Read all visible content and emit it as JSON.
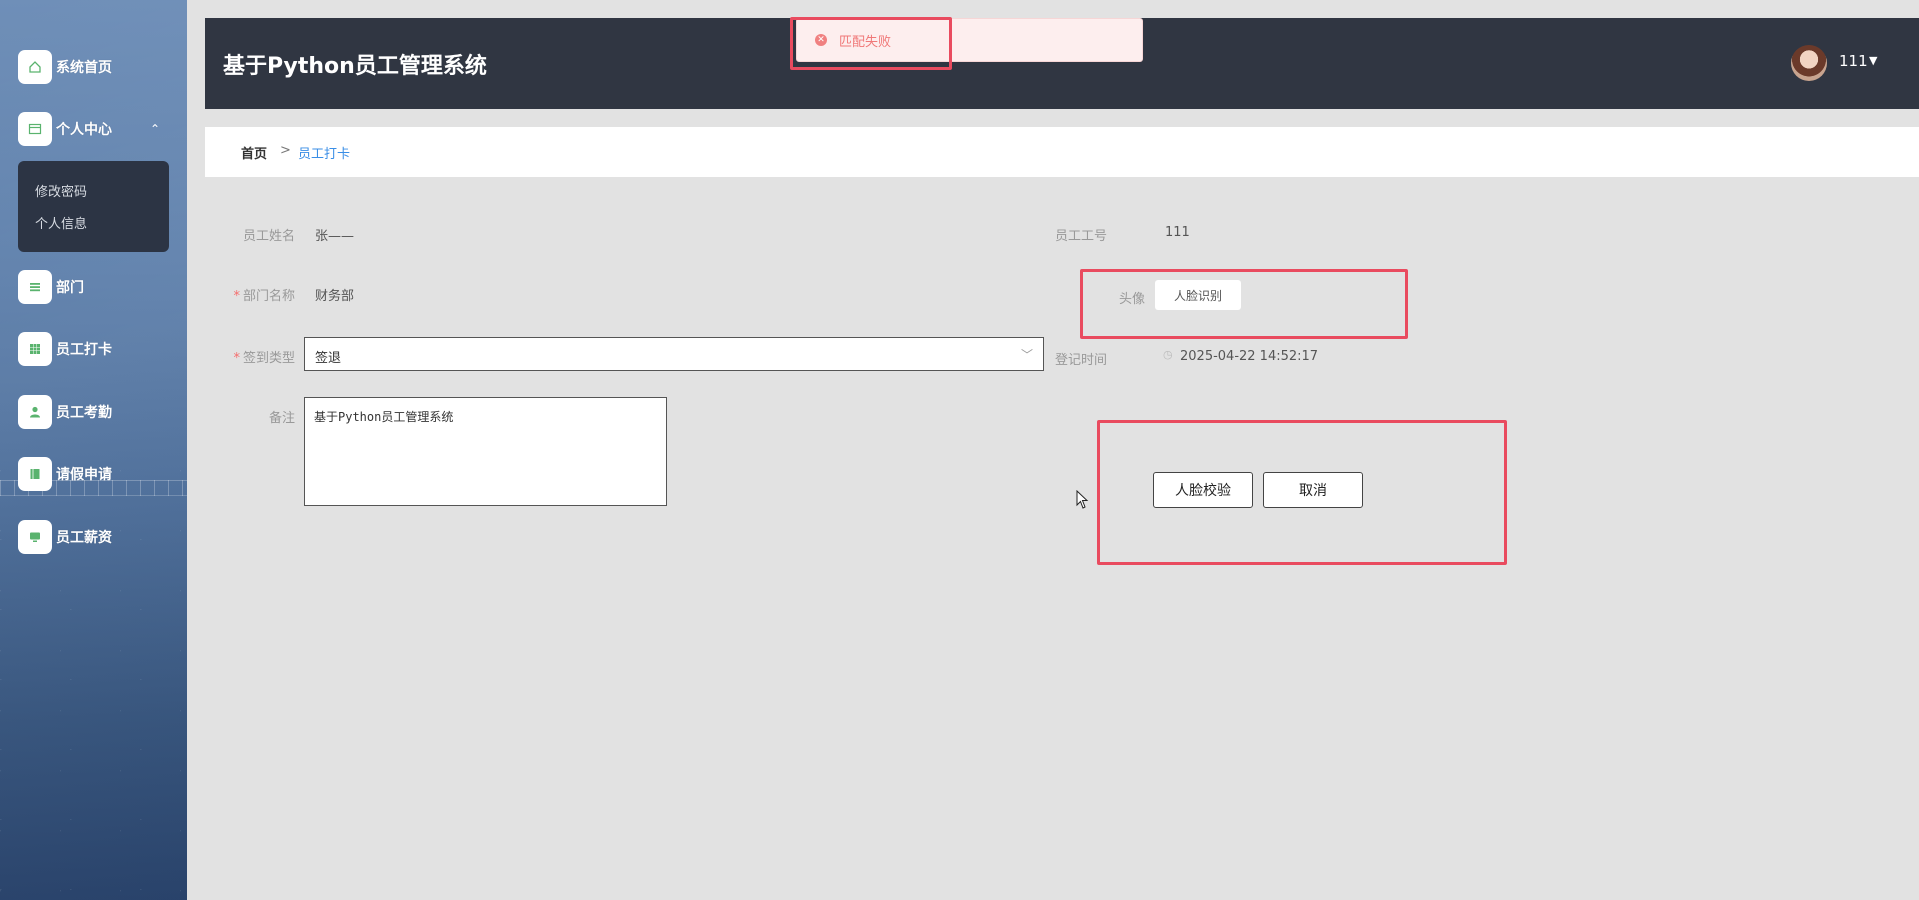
{
  "app": {
    "title": "基于Python员工管理系统"
  },
  "user": {
    "name": "111"
  },
  "toast": {
    "message": "匹配失败"
  },
  "sidebar": {
    "items": [
      {
        "label": "系统首页",
        "icon": "home-icon"
      },
      {
        "label": "个人中心",
        "icon": "user-card-icon"
      },
      {
        "label": "部门",
        "icon": "list-icon"
      },
      {
        "label": "员工打卡",
        "icon": "grid-icon"
      },
      {
        "label": "员工考勤",
        "icon": "person-icon"
      },
      {
        "label": "请假申请",
        "icon": "book-icon"
      },
      {
        "label": "员工薪资",
        "icon": "monitor-icon"
      }
    ],
    "submenu": [
      {
        "label": "修改密码"
      },
      {
        "label": "个人信息"
      }
    ]
  },
  "breadcrumb": {
    "home": "首页",
    "separator": ">",
    "current": "员工打卡"
  },
  "form": {
    "name_label": "员工姓名",
    "name_value": "张——",
    "dept_label": "部门名称",
    "dept_value": "财务部",
    "type_label": "签到类型",
    "type_value": "签退",
    "remark_label": "备注",
    "remark_value": "基于Python员工管理系统",
    "empno_label": "员工工号",
    "empno_value": "111",
    "avatar_label": "头像",
    "face_button": "人脸识别",
    "time_label": "登记时间",
    "time_value": "2025-04-22 14:52:17",
    "verify_button": "人脸校验",
    "cancel_button": "取消"
  },
  "colors": {
    "highlight": "#e94b5f",
    "header": "#303642",
    "link": "#3a8ee6",
    "error": "#f07878"
  }
}
